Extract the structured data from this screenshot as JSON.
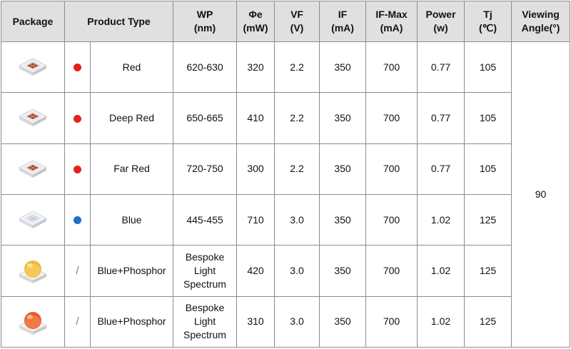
{
  "colors": {
    "header_bg": "#e0e0e0",
    "border": "#8c8c8c",
    "red_dot": "#e8201c",
    "blue_dot": "#1f6fc8"
  },
  "headers": {
    "package": "Package",
    "product_type": "Product Type",
    "wp": [
      "WP",
      "(nm)"
    ],
    "phie": [
      "Φe",
      "(mW)"
    ],
    "vf": [
      "VF",
      "(V)"
    ],
    "if": [
      "IF",
      "(mA)"
    ],
    "if_max": [
      "IF-Max",
      "(mA)"
    ],
    "power": [
      "Power",
      "(w)"
    ],
    "tj": [
      "Tj",
      "(℃)"
    ],
    "viewing": [
      "Viewing",
      "Angle(°)"
    ]
  },
  "viewing_angle": "90",
  "rows": [
    {
      "package_icon": "red-led-package-icon",
      "indicator": "red-dot",
      "indicator_text": "",
      "type": "Red",
      "wp": "620-630",
      "phie": "320",
      "vf": "2.2",
      "if": "350",
      "if_max": "700",
      "power": "0.77",
      "tj": "105"
    },
    {
      "package_icon": "red-led-package-icon",
      "indicator": "red-dot",
      "indicator_text": "",
      "type": "Deep Red",
      "wp": "650-665",
      "phie": "410",
      "vf": "2.2",
      "if": "350",
      "if_max": "700",
      "power": "0.77",
      "tj": "105"
    },
    {
      "package_icon": "red-led-package-icon",
      "indicator": "red-dot",
      "indicator_text": "",
      "type": "Far Red",
      "wp": "720-750",
      "phie": "300",
      "vf": "2.2",
      "if": "350",
      "if_max": "700",
      "power": "0.77",
      "tj": "105"
    },
    {
      "package_icon": "clear-led-package-icon",
      "indicator": "blue-dot",
      "indicator_text": "",
      "type": "Blue",
      "wp": "445-455",
      "phie": "710",
      "vf": "3.0",
      "if": "350",
      "if_max": "700",
      "power": "1.02",
      "tj": "125"
    },
    {
      "package_icon": "yellow-dome-led-package-icon",
      "indicator": "slash",
      "indicator_text": "/",
      "type": "Blue+Phosphor",
      "wp": [
        "Bespoke",
        "Light",
        "Spectrum"
      ],
      "phie": "420",
      "vf": "3.0",
      "if": "350",
      "if_max": "700",
      "power": "1.02",
      "tj": "125"
    },
    {
      "package_icon": "orange-dome-led-package-icon",
      "indicator": "slash",
      "indicator_text": "/",
      "type": "Blue+Phosphor",
      "wp": [
        "Bespoke",
        "Light",
        "Spectrum"
      ],
      "phie": "310",
      "vf": "3.0",
      "if": "350",
      "if_max": "700",
      "power": "1.02",
      "tj": "125"
    }
  ]
}
